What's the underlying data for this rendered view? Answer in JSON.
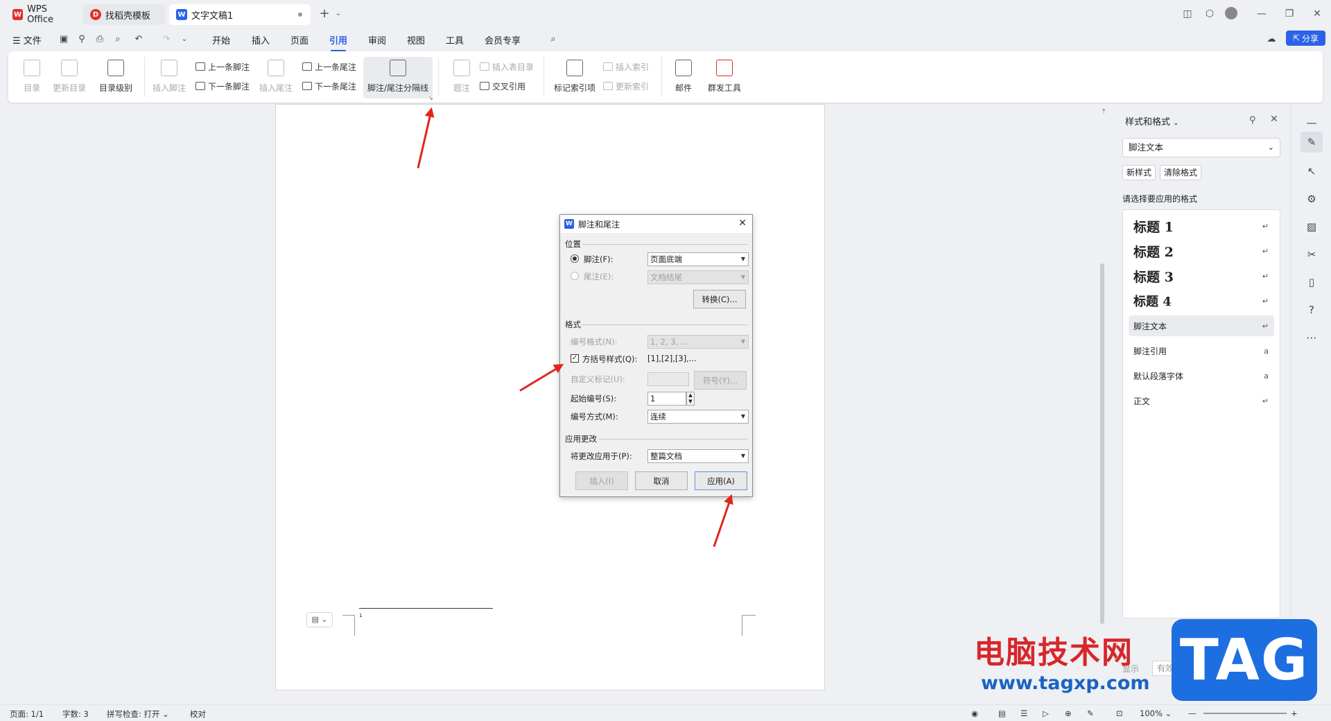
{
  "tabs": [
    {
      "label": "WPS Office"
    },
    {
      "label": "找稻壳模板"
    },
    {
      "label": "文字文稿1"
    }
  ],
  "menu": {
    "file": "文件",
    "items": [
      "开始",
      "插入",
      "页面",
      "引用",
      "审阅",
      "视图",
      "工具",
      "会员专享"
    ],
    "active": "引用",
    "share": "分享"
  },
  "ribbon": {
    "toc": "目录",
    "update_toc": "更新目录",
    "toc_level": "目录级别",
    "insert_footnote": "插入脚注",
    "prev_footnote": "上一条脚注",
    "next_footnote": "下一条脚注",
    "insert_endnote": "插入尾注",
    "prev_endnote": "上一条尾注",
    "next_endnote": "下一条尾注",
    "separator": "脚注/尾注分隔线",
    "caption": "题注",
    "insert_table_of_figures": "插入表目录",
    "cross_ref": "交叉引用",
    "mark_index": "标记索引项",
    "insert_index": "插入索引",
    "update_index": "更新索引",
    "mail": "邮件",
    "mass_tool": "群发工具"
  },
  "dialog": {
    "title": "脚注和尾注",
    "position_group": "位置",
    "footnote_label": "脚注(F):",
    "footnote_value": "页面底端",
    "endnote_label": "尾注(E):",
    "endnote_value": "文档结尾",
    "convert": "转换(C)...",
    "format_group": "格式",
    "number_format_label": "编号格式(N):",
    "number_format_value": "1, 2, 3, ...",
    "bracket_label": "方括号样式(Q):",
    "bracket_value": "[1],[2],[3],...",
    "custom_mark_label": "自定义标记(U):",
    "symbol": "符号(Y)...",
    "start_label": "起始编号(S):",
    "start_value": "1",
    "numbering_label": "编号方式(M):",
    "numbering_value": "连续",
    "apply_group": "应用更改",
    "apply_to_label": "将更改应用于(P):",
    "apply_to_value": "整篇文档",
    "insert": "插入(I)",
    "cancel": "取消",
    "apply": "应用(A)"
  },
  "style_panel": {
    "title": "样式和格式",
    "current": "脚注文本",
    "new_style": "新样式",
    "clear_format": "清除格式",
    "prompt": "请选择要应用的格式",
    "styles": [
      "标题 1",
      "标题 2",
      "标题 3",
      "标题 4",
      "脚注文本",
      "脚注引用",
      "默认段落字体",
      "正文"
    ],
    "selected": "脚注文本",
    "show_label": "显示",
    "show_value": "有效样式"
  },
  "doc": {
    "footnote_marker": "1"
  },
  "statusbar": {
    "page": "页面: 1/1",
    "words": "字数: 3",
    "spell": "拼写检查: 打开",
    "proof": "校对",
    "zoom": "100%"
  },
  "watermark": {
    "site_name": "电脑技术网",
    "url": "www.tagxp.com",
    "tag": "TAG"
  },
  "colors": {
    "accent": "#2b62e8",
    "arrow": "#e0261d",
    "wps_red": "#e0322b"
  }
}
